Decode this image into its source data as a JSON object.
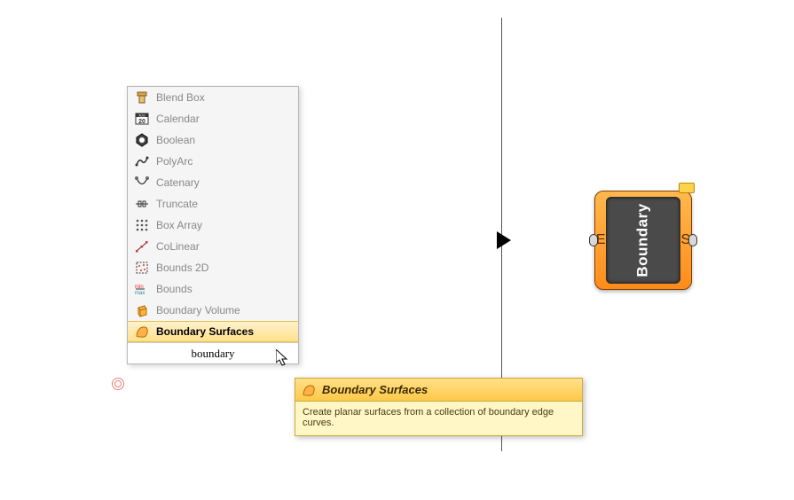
{
  "menu": {
    "items": [
      {
        "label": "Blend Box"
      },
      {
        "label": "Calendar"
      },
      {
        "label": "Boolean"
      },
      {
        "label": "PolyArc"
      },
      {
        "label": "Catenary"
      },
      {
        "label": "Truncate"
      },
      {
        "label": "Box Array"
      },
      {
        "label": "CoLinear"
      },
      {
        "label": "Bounds 2D"
      },
      {
        "label": "Bounds"
      },
      {
        "label": "Boundary Volume"
      },
      {
        "label": "Boundary Surfaces"
      }
    ],
    "selected_index": 11,
    "search_text": "boundary"
  },
  "tooltip": {
    "title": "Boundary Surfaces",
    "body": "Create planar surfaces from a collection of boundary edge curves."
  },
  "component": {
    "name": "Boundary",
    "input_label": "E",
    "output_label": "S"
  }
}
